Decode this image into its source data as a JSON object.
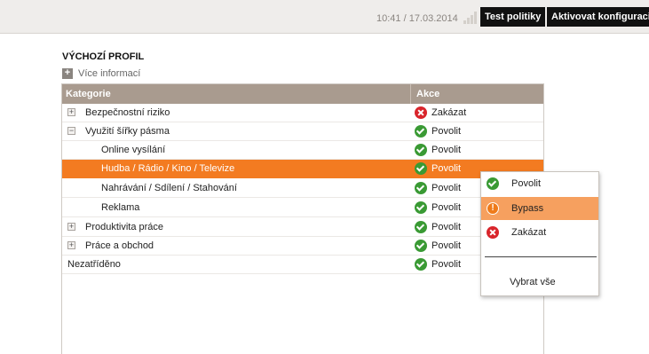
{
  "header": {
    "datetime": "10:41 / 17.03.2014",
    "test_policy_button": "Test politiky",
    "activate_config_button": "Aktivovat konfiguraci"
  },
  "profile": {
    "title": "VÝCHOZÍ PROFIL",
    "more_info": "Více informací"
  },
  "table": {
    "col_category": "Kategorie",
    "col_action": "Akce",
    "rows": [
      {
        "expander": "+",
        "category": "Bezpečnostní riziko",
        "action": "Zakázat"
      },
      {
        "expander": "−",
        "category": "Využití šířky pásma",
        "action": "Povolit"
      },
      {
        "expander": "",
        "category": "Online vysílání",
        "action": "Povolit"
      },
      {
        "expander": "",
        "category": "Hudba / Rádio / Kino / Televize",
        "action": "Povolit"
      },
      {
        "expander": "",
        "category": "Nahrávání / Sdílení / Stahování",
        "action": "Povolit"
      },
      {
        "expander": "",
        "category": "Reklama",
        "action": "Povolit"
      },
      {
        "expander": "+",
        "category": "Produktivita práce",
        "action": "Povolit"
      },
      {
        "expander": "+",
        "category": "Práce a obchod",
        "action": "Povolit"
      },
      {
        "expander": "",
        "category": "Nezatříděno",
        "action": "Povolit"
      }
    ]
  },
  "action_menu": {
    "allow": "Povolit",
    "bypass": "Bypass",
    "block": "Zakázat",
    "select_all": "Vybrat vše"
  },
  "colors": {
    "selected_row": "#f37b21",
    "menu_highlight": "#f6a05f",
    "table_header": "#a99b8f",
    "allow_icon": "#3a9a34",
    "block_icon": "#d9252b"
  }
}
